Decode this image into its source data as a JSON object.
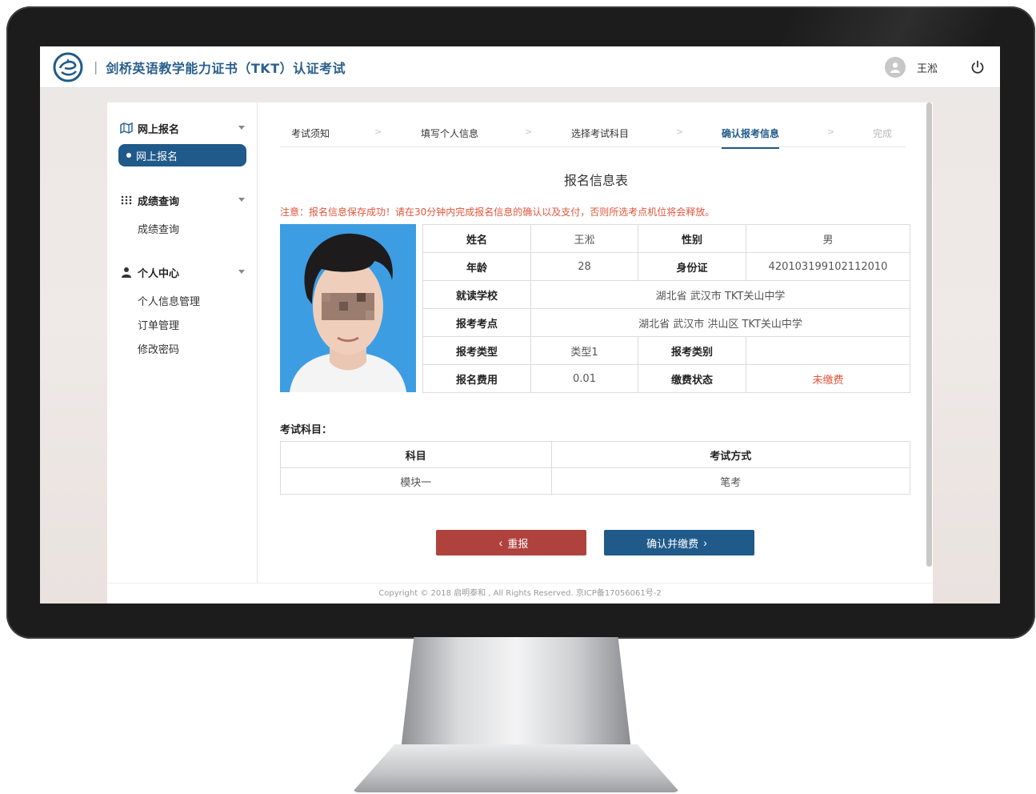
{
  "app": {
    "title": "剑桥英语教学能力证书（TKT）认证考试",
    "separator": "|",
    "user_name": "王淞"
  },
  "sidebar": {
    "groups": [
      {
        "label": "网上报名",
        "icon": "map-icon",
        "items": [
          {
            "label": "网上报名",
            "active": true
          }
        ]
      },
      {
        "label": "成绩查询",
        "icon": "grid-icon",
        "items": [
          {
            "label": "成绩查询",
            "active": false
          }
        ]
      },
      {
        "label": "个人中心",
        "icon": "person-icon",
        "items": [
          {
            "label": "个人信息管理",
            "active": false
          },
          {
            "label": "订单管理",
            "active": false
          },
          {
            "label": "修改密码",
            "active": false
          }
        ]
      }
    ]
  },
  "steps": [
    {
      "label": "考试须知",
      "state": "normal"
    },
    {
      "label": "填写个人信息",
      "state": "normal"
    },
    {
      "label": "选择考试科目",
      "state": "normal"
    },
    {
      "label": "确认报考信息",
      "state": "active"
    },
    {
      "label": "完成",
      "state": "pending"
    }
  ],
  "step_arrow": ">",
  "form": {
    "title": "报名信息表",
    "notice": "注意：报名信息保存成功！请在30分钟内完成报名信息的确认以及支付，否则所选考点机位将会释放。",
    "rows": [
      {
        "l1": "姓名",
        "v1": "王淞",
        "l2": "性别",
        "v2": "男"
      },
      {
        "l1": "年龄",
        "v1": "28",
        "l2": "身份证",
        "v2": "420103199102112010"
      },
      {
        "l1": "就读学校",
        "span": "湖北省 武汉市 TKT关山中学"
      },
      {
        "l1": "报考考点",
        "span": "湖北省 武汉市 洪山区 TKT关山中学"
      },
      {
        "l1": "报考类型",
        "v1": "类型1",
        "l2": "报考类别",
        "v2": ""
      },
      {
        "l1": "报名费用",
        "v1": "0.01",
        "l2": "缴费状态",
        "v2": "未缴费"
      }
    ],
    "status_color": "#e2553c"
  },
  "subjects": {
    "title": "考试科目：",
    "headers": [
      "科目",
      "考试方式"
    ],
    "rows": [
      [
        "模块一",
        "笔考"
      ]
    ]
  },
  "buttons": {
    "redo": "重报",
    "confirm": "确认并缴费"
  },
  "footer": "Copyright © 2018 启明泰和 , All Rights Reserved. 京ICP备17056061号-2",
  "colors": {
    "brand": "#1f5a8a",
    "danger": "#b0423e",
    "warning_text": "#e2553c"
  }
}
